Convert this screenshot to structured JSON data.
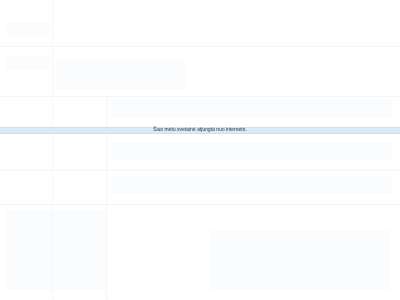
{
  "notice": {
    "message": "Šiuo metu svetainė atjungta nuo interneto."
  }
}
